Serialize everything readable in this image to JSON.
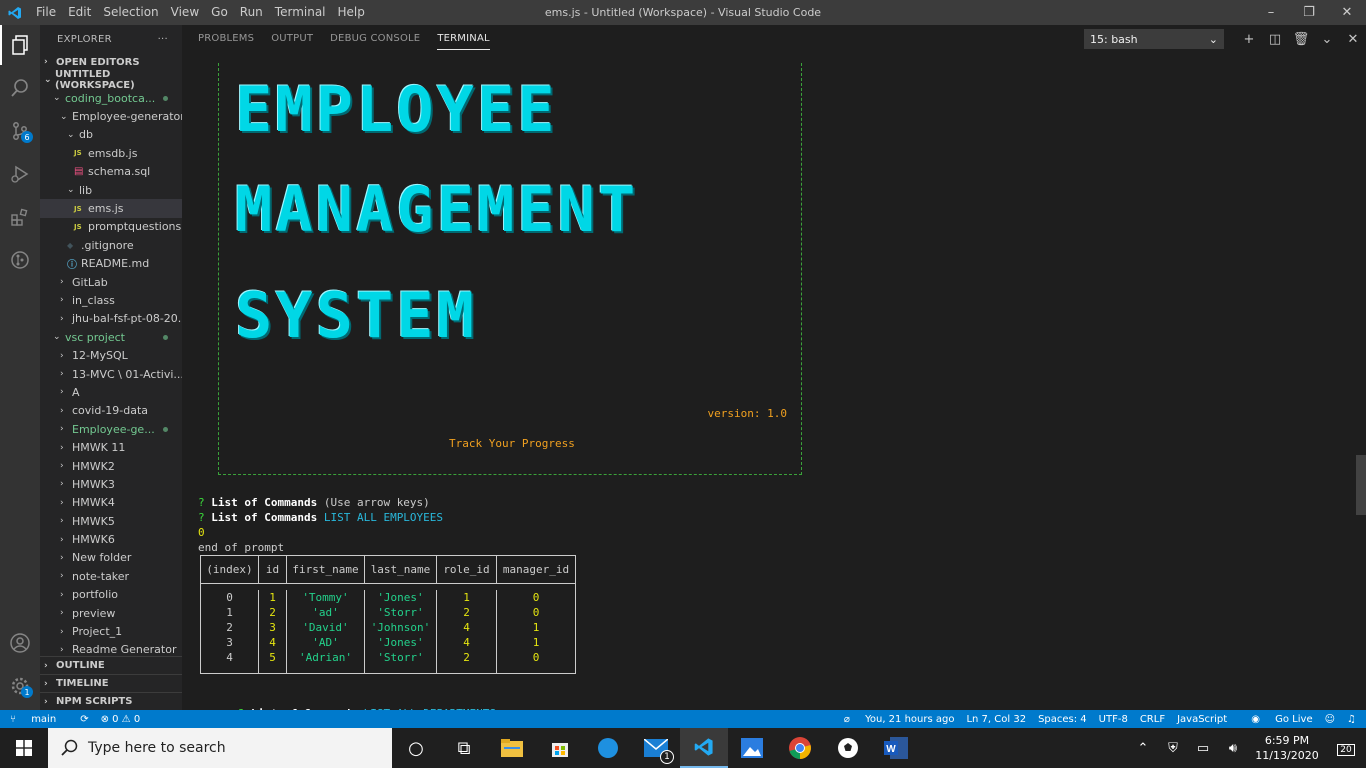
{
  "titlebar": {
    "menu": [
      "File",
      "Edit",
      "Selection",
      "View",
      "Go",
      "Run",
      "Terminal",
      "Help"
    ],
    "title": "ems.js - Untitled (Workspace) - Visual Studio Code"
  },
  "activitybar": {
    "scm_badge": "6",
    "settings_badge": "1"
  },
  "sidebar": {
    "header": "EXPLORER",
    "open_editors": "OPEN EDITORS",
    "workspace": "UNTITLED (WORKSPACE)",
    "tree": [
      {
        "label": "coding_bootca...",
        "indent": 1,
        "chev": "v",
        "green": true,
        "dot": true
      },
      {
        "label": "Employee-generator",
        "indent": 2,
        "chev": "v"
      },
      {
        "label": "db",
        "indent": 3,
        "chev": "v"
      },
      {
        "label": "emsdb.js",
        "indent": 4,
        "icon": "JS"
      },
      {
        "label": "schema.sql",
        "indent": 4,
        "icon": "db"
      },
      {
        "label": "lib",
        "indent": 3,
        "chev": "v"
      },
      {
        "label": "ems.js",
        "indent": 4,
        "icon": "JS",
        "active": true
      },
      {
        "label": "promptquestions.js",
        "indent": 4,
        "icon": "JS"
      },
      {
        "label": ".gitignore",
        "indent": 3,
        "icon": "git"
      },
      {
        "label": "README.md",
        "indent": 3,
        "icon": "info"
      },
      {
        "label": "GitLab",
        "indent": 2,
        "chev": ">"
      },
      {
        "label": "in_class",
        "indent": 2,
        "chev": ">"
      },
      {
        "label": "jhu-bal-fsf-pt-08-20...",
        "indent": 2,
        "chev": ">"
      },
      {
        "label": "vsc project",
        "indent": 1,
        "chev": "v",
        "green": true,
        "dot": true
      },
      {
        "label": "12-MySQL",
        "indent": 2,
        "chev": ">"
      },
      {
        "label": "13-MVC \\ 01-Activi...",
        "indent": 2,
        "chev": ">"
      },
      {
        "label": "A",
        "indent": 2,
        "chev": ">"
      },
      {
        "label": "covid-19-data",
        "indent": 2,
        "chev": ">"
      },
      {
        "label": "Employee-ge...",
        "indent": 2,
        "chev": ">",
        "green": true,
        "dot": true
      },
      {
        "label": "HMWK 11",
        "indent": 2,
        "chev": ">"
      },
      {
        "label": "HMWK2",
        "indent": 2,
        "chev": ">"
      },
      {
        "label": "HMWK3",
        "indent": 2,
        "chev": ">"
      },
      {
        "label": "HMWK4",
        "indent": 2,
        "chev": ">"
      },
      {
        "label": "HMWK5",
        "indent": 2,
        "chev": ">"
      },
      {
        "label": "HMWK6",
        "indent": 2,
        "chev": ">"
      },
      {
        "label": "New folder",
        "indent": 2,
        "chev": ">"
      },
      {
        "label": "note-taker",
        "indent": 2,
        "chev": ">"
      },
      {
        "label": "portfolio",
        "indent": 2,
        "chev": ">"
      },
      {
        "label": "preview",
        "indent": 2,
        "chev": ">"
      },
      {
        "label": "Project_1",
        "indent": 2,
        "chev": ">"
      },
      {
        "label": "Readme Generator",
        "indent": 2,
        "chev": ">"
      }
    ],
    "bottom_sections": [
      "OUTLINE",
      "TIMELINE",
      "NPM SCRIPTS"
    ]
  },
  "panel": {
    "tabs": [
      "PROBLEMS",
      "OUTPUT",
      "DEBUG CONSOLE",
      "TERMINAL"
    ],
    "active_tab": "TERMINAL",
    "terminal_select": "15: bash"
  },
  "terminal": {
    "banner_words": [
      "EMPLOYEE",
      "MANAGEMENT",
      "SYSTEM"
    ],
    "version": "version: 1.0",
    "tagline": "Track Your Progress",
    "lines": [
      {
        "prefix": "? ",
        "label": "List of Commands",
        "rest": " (Use arrow keys)",
        "rest_color": "plain"
      },
      {
        "prefix": "? ",
        "label": "List of Commands",
        "rest": " LIST ALL EMPLOYEES",
        "rest_color": "cyan"
      },
      {
        "text": "0",
        "color": "yel"
      },
      {
        "text": "end of prompt",
        "color": "plain"
      }
    ],
    "last_line": {
      "prefix": "? ",
      "label": "List of Commands",
      "rest": " LIST ALL DEPARTMENTS"
    },
    "table": {
      "headers": [
        "(index)",
        "id",
        "first_name",
        "last_name",
        "role_id",
        "manager_id"
      ],
      "rows": [
        [
          "0",
          "1",
          "'Tommy'",
          "'Jones'",
          "1",
          "0"
        ],
        [
          "1",
          "2",
          "'ad'",
          "'Storr'",
          "2",
          "0"
        ],
        [
          "2",
          "3",
          "'David'",
          "'Johnson'",
          "4",
          "1"
        ],
        [
          "3",
          "4",
          "'AD'",
          "'Jones'",
          "4",
          "1"
        ],
        [
          "4",
          "5",
          "'Adrian'",
          "'Storr'",
          "2",
          "0"
        ]
      ]
    }
  },
  "statusbar": {
    "branch": "main",
    "sync": "⟳",
    "problems": "⊗ 0 ⚠ 0",
    "blame": "You, 21 hours ago",
    "cursor": "Ln 7, Col 32",
    "spaces": "Spaces: 4",
    "encoding": "UTF-8",
    "eol": "CRLF",
    "language": "JavaScript",
    "golive": "Go Live"
  },
  "taskbar": {
    "search_placeholder": "Type here to search",
    "mail_badge": "1",
    "time": "6:59 PM",
    "date": "11/13/2020",
    "notif_count": "20"
  }
}
